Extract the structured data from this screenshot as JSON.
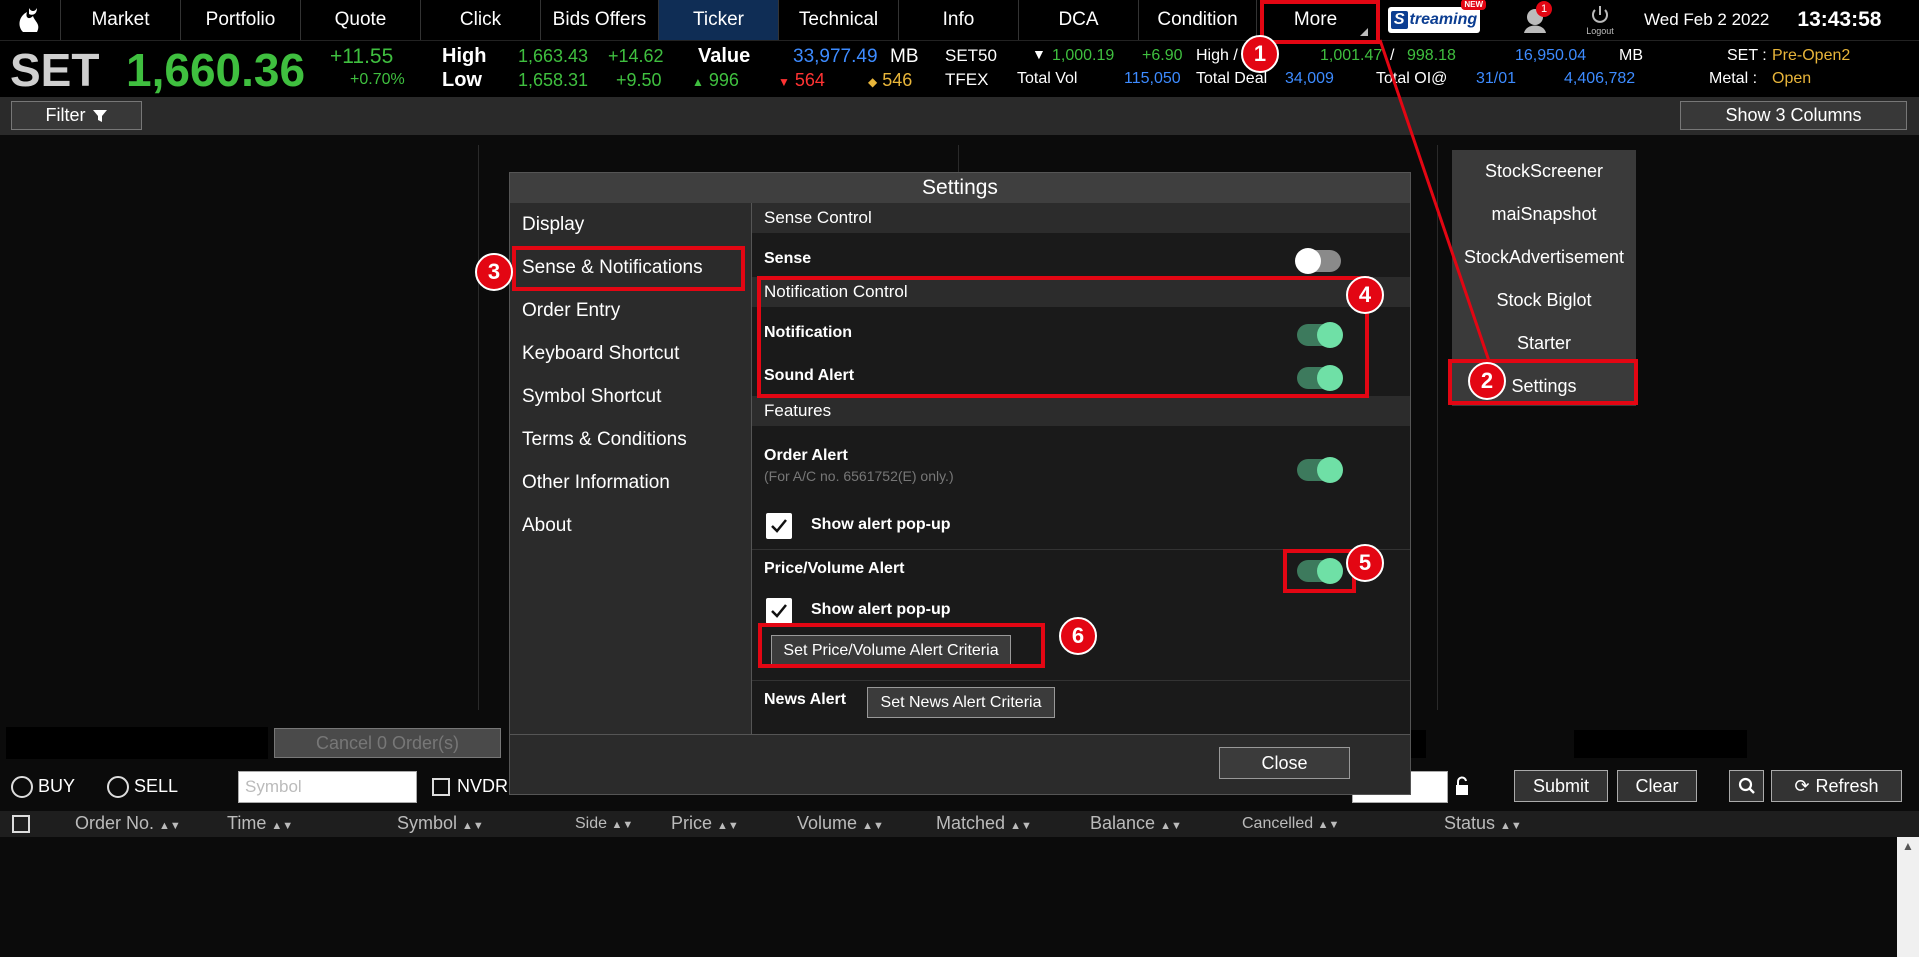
{
  "nav": {
    "tabs": [
      "Market",
      "Portfolio",
      "Quote",
      "Click",
      "Bids Offers",
      "Ticker",
      "Technical",
      "Info",
      "DCA",
      "Condition",
      "More"
    ],
    "active_tab": "Ticker",
    "streaming_label": "treaming",
    "streaming_new": "NEW",
    "notification_count": "1",
    "logout_label": "Logout",
    "date": "Wed Feb 2 2022",
    "time": "13:43:58"
  },
  "index": {
    "name": "SET",
    "value": "1,660.36",
    "change": "+11.55",
    "change_pct": "+0.70%",
    "high_label": "High",
    "low_label": "Low",
    "high_value": "1,663.43",
    "high_change": "+14.62",
    "low_value": "1,658.31",
    "low_change": "+9.50",
    "value_label": "Value",
    "value_amount": "33,977.49",
    "value_unit": "MB",
    "up_count": "996",
    "down_count": "564",
    "unch_count": "546",
    "set50_label": "SET50",
    "set50_value": "1,000.19",
    "set50_change": "+6.90",
    "set50_high_label": "High /",
    "set50_high": "1,001.47",
    "set50_slash": "/",
    "set50_low": "998.18",
    "set50_vol": "16,950.04",
    "set50_unit": "MB",
    "tfex_label": "TFEX",
    "total_vol_label": "Total Vol",
    "total_vol": "115,050",
    "total_deal_label": "Total Deal",
    "total_deal": "34,009",
    "total_oi_label": "Total OI@",
    "oi_date": "31/01",
    "oi_value": "4,406,782",
    "set_status_label": "SET :",
    "set_status": "Pre-Open2",
    "metal_label": "Metal :",
    "metal_status": "Open"
  },
  "toolbar": {
    "filter_label": "Filter",
    "show_columns_label": "Show 3 Columns"
  },
  "more_menu": {
    "items": [
      "StockScreener",
      "maiSnapshot",
      "StockAdvertisement",
      "Stock Biglot",
      "Starter",
      "Settings"
    ]
  },
  "settings": {
    "title": "Settings",
    "left_items": [
      "Display",
      "Sense & Notifications",
      "Order Entry",
      "Keyboard Shortcut",
      "Symbol Shortcut",
      "Terms & Conditions",
      "Other Information",
      "About"
    ],
    "sense_control_header": "Sense Control",
    "sense_label": "Sense",
    "sense_on": false,
    "notification_control_header": "Notification Control",
    "notification_label": "Notification",
    "notification_on": true,
    "sound_alert_label": "Sound Alert",
    "sound_alert_on": true,
    "features_header": "Features",
    "order_alert_label": "Order Alert",
    "order_alert_note": "(For A/C no. 6561752(E) only.)",
    "order_alert_on": true,
    "show_popup_label": "Show alert pop-up",
    "price_volume_alert_label": "Price/Volume Alert",
    "price_volume_alert_on": true,
    "set_pv_criteria_label": "Set Price/Volume Alert Criteria",
    "news_alert_label": "News Alert",
    "set_news_criteria_label": "Set News Alert Criteria",
    "close_label": "Close"
  },
  "annotations": [
    "1",
    "2",
    "3",
    "4",
    "5",
    "6"
  ],
  "order_panel": {
    "cancel_label": "Cancel 0 Order(s)",
    "buy_label": "BUY",
    "sell_label": "SELL",
    "symbol_placeholder": "Symbol",
    "nvdr_label": "NVDR",
    "submit_label": "Submit",
    "clear_label": "Clear",
    "refresh_label": "Refresh",
    "columns": [
      "Order No.",
      "Time",
      "Symbol",
      "Side",
      "Price",
      "Volume",
      "Matched",
      "Balance",
      "Cancelled",
      "Status"
    ]
  },
  "colors": {
    "positive": "#3fbf3f",
    "negative": "#ff3333",
    "info_blue": "#3d8bff",
    "status_yellow": "#e8b53a",
    "annotation_red": "#e30613",
    "toggle_on": "#6fe0a6",
    "active_tab": "#0f2d55"
  }
}
